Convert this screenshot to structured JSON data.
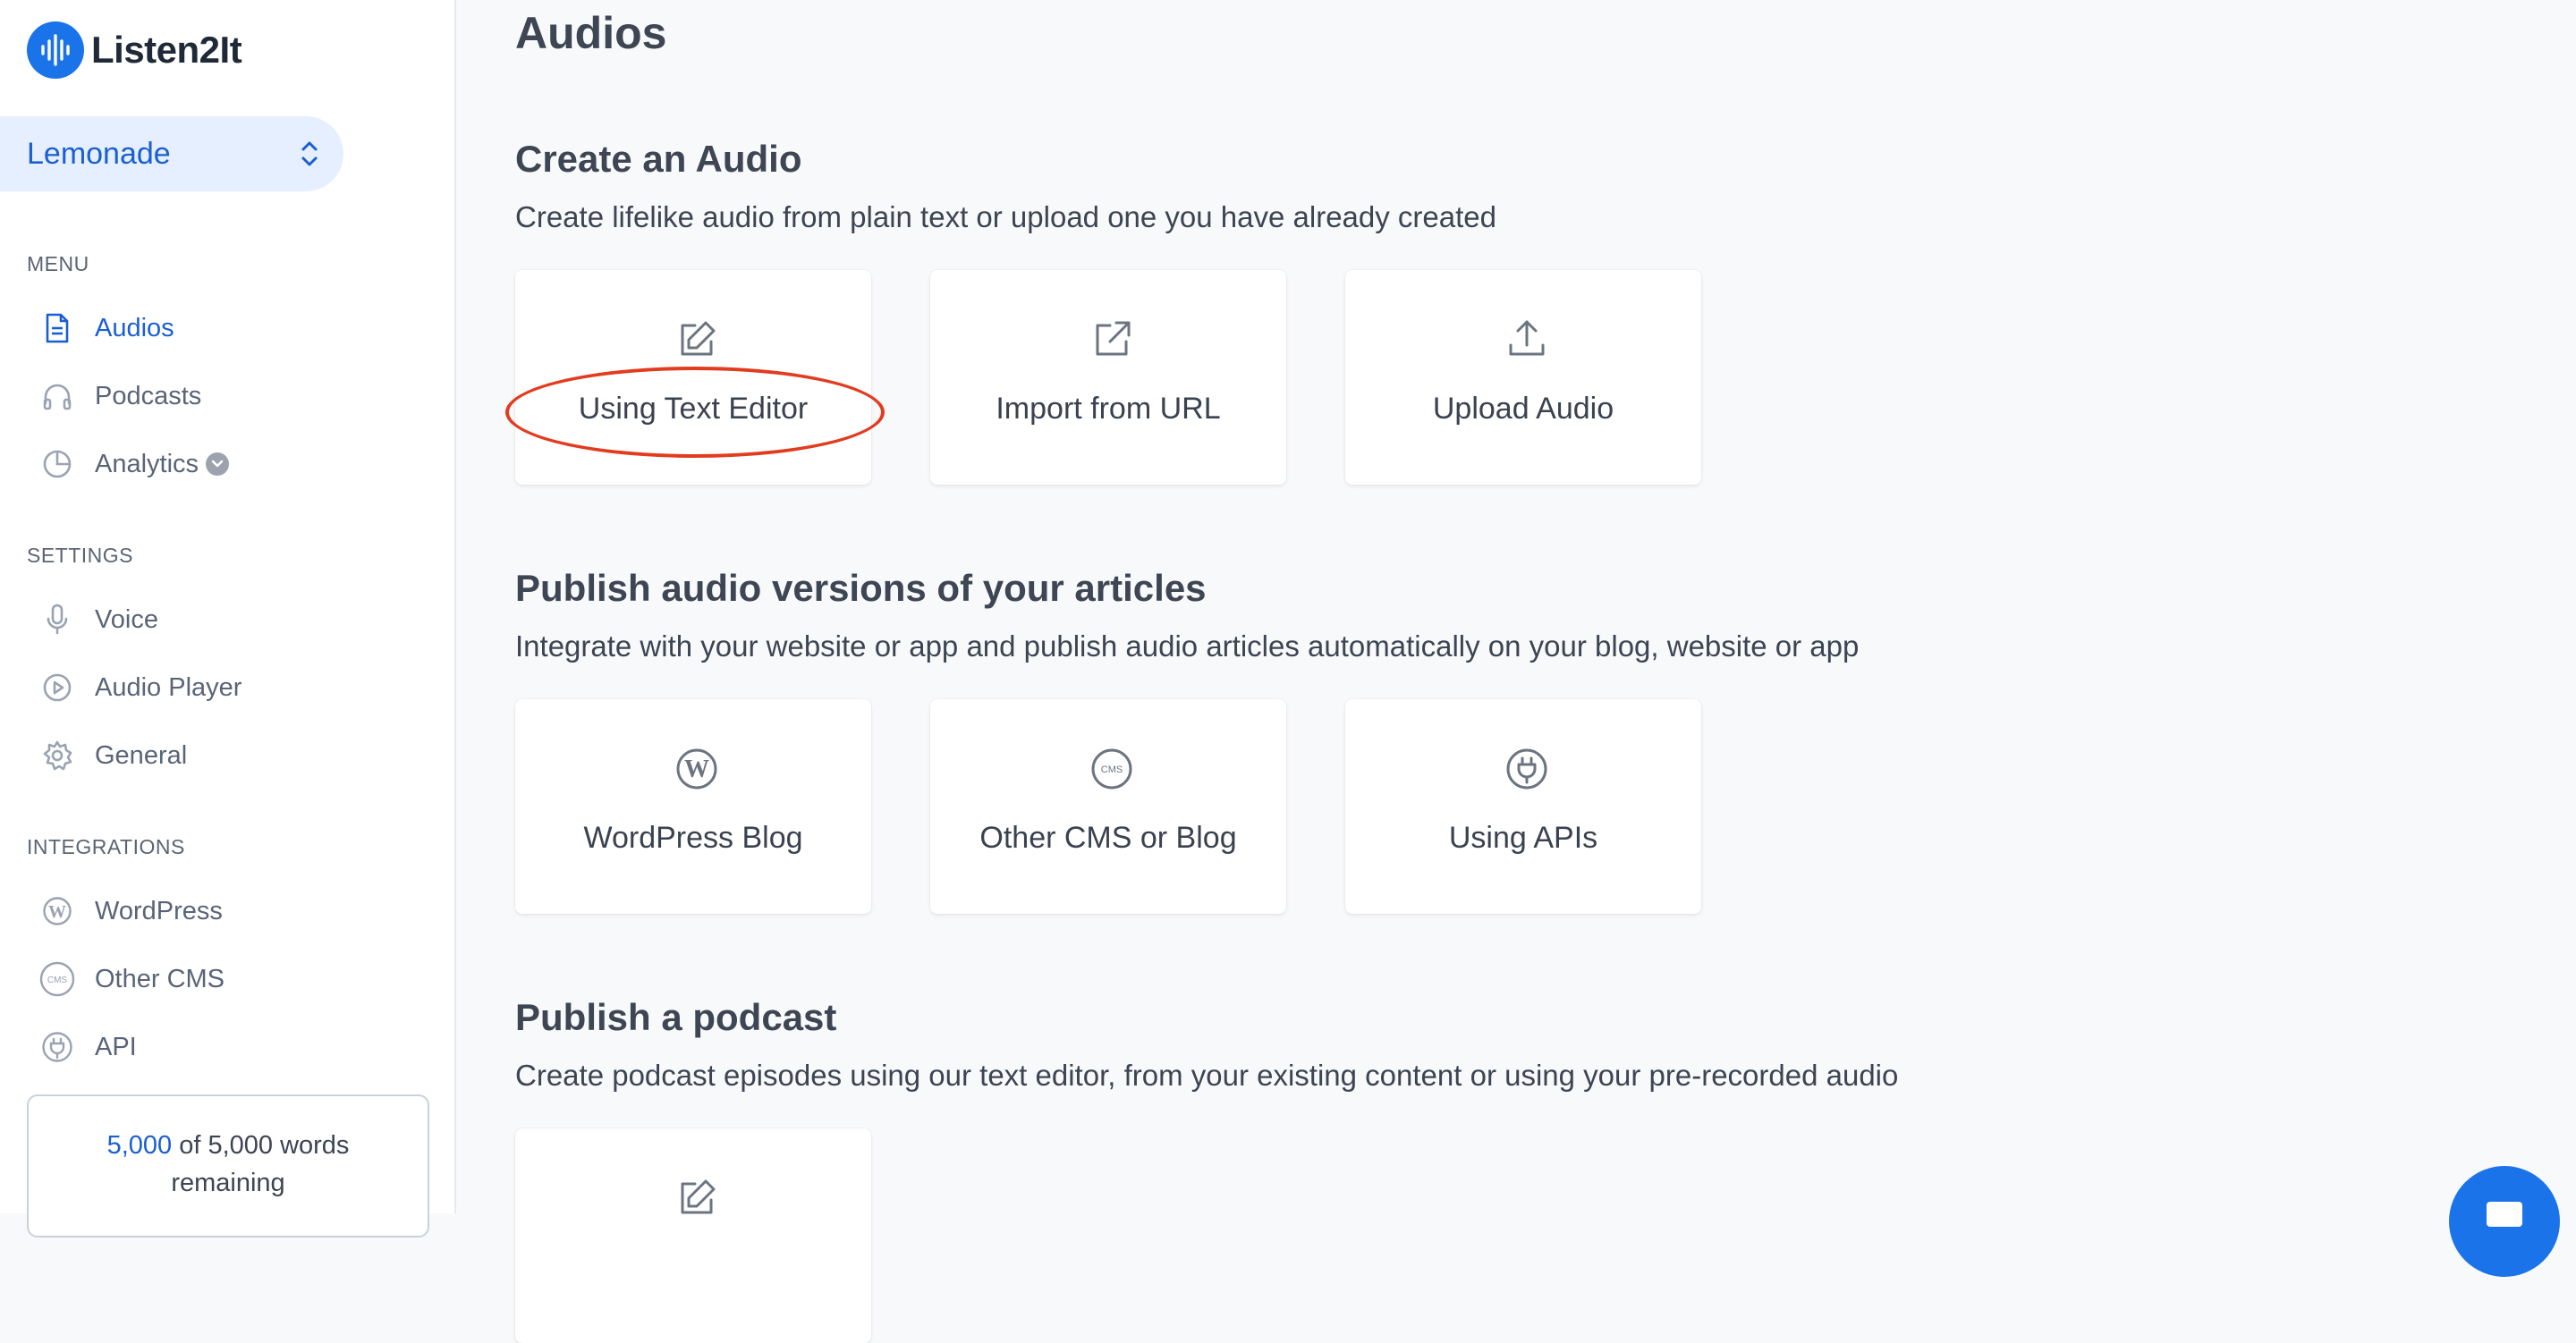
{
  "brand": {
    "name": "Listen2It",
    "accent": "#1a73e8",
    "active_text": "#1a5fd0"
  },
  "workspace": {
    "name": "Lemonade",
    "icon": "chevron-up-down-icon"
  },
  "sidebar": {
    "menu_label": "MENU",
    "menu_items": [
      {
        "label": "Audios",
        "icon": "document-icon",
        "active": true
      },
      {
        "label": "Podcasts",
        "icon": "headphones-icon"
      },
      {
        "label": "Analytics",
        "icon": "pie-chart-icon"
      }
    ],
    "settings_label": "SETTINGS",
    "settings_items": [
      {
        "label": "Voice",
        "icon": "microphone-icon"
      },
      {
        "label": "Audio Player",
        "icon": "play-circle-icon"
      },
      {
        "label": "General",
        "icon": "gear-icon"
      }
    ],
    "integrations_label": "INTEGRATIONS",
    "integrations_items": [
      {
        "label": "WordPress",
        "icon": "wordpress-icon"
      },
      {
        "label": "Other CMS",
        "icon": "cms-icon"
      },
      {
        "label": "API",
        "icon": "plug-icon"
      }
    ],
    "quota": {
      "used": "5,000",
      "rest": "of 5,000 words",
      "suffix": "remaining"
    }
  },
  "main": {
    "title": "Audios",
    "sections": [
      {
        "title": "Create an Audio",
        "description": "Create lifelike audio from plain text or upload one you have already created",
        "cards": [
          {
            "label": "Using Text Editor",
            "icon": "edit-icon"
          },
          {
            "label": "Import from URL",
            "icon": "external-link-icon"
          },
          {
            "label": "Upload Audio",
            "icon": "upload-icon"
          }
        ]
      },
      {
        "title": "Publish audio versions of your articles",
        "description": "Integrate with your website or app and publish audio articles automatically on your blog, website or app",
        "cards": [
          {
            "label": "WordPress Blog",
            "icon": "wordpress-icon"
          },
          {
            "label": "Other CMS or Blog",
            "icon": "cms-icon",
            "icon_text": "CMS"
          },
          {
            "label": "Using APIs",
            "icon": "plug-icon"
          }
        ]
      },
      {
        "title": "Publish a podcast",
        "description": "Create podcast episodes using our text editor, from your existing content or using your pre-recorded audio",
        "cards": [
          {
            "label": "",
            "icon": "edit-icon"
          }
        ]
      }
    ]
  },
  "annotation": {
    "color": "#e23b1d",
    "target": "Using Text Editor"
  },
  "chat_widget": {
    "icon": "chat-icon"
  }
}
